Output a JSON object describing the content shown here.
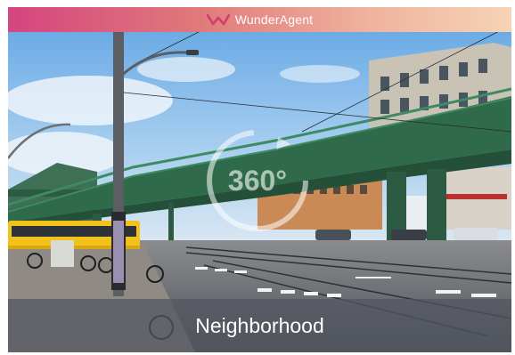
{
  "header": {
    "brand_name": "WunderAgent",
    "logo_icon": "wunderagent-logo-icon",
    "gradient": [
      "#d4457f",
      "#e07a7a",
      "#efb39e",
      "#f6d3b6"
    ]
  },
  "viewer": {
    "badge_text": "360°",
    "badge_icon": "rotate-360-icon"
  },
  "caption": {
    "label": "Neighborhood"
  },
  "colors": {
    "sky": "#8cc0ea",
    "bridge": "#2f6b4a",
    "tram": "#f2c21a",
    "caption_overlay": "#525660"
  }
}
